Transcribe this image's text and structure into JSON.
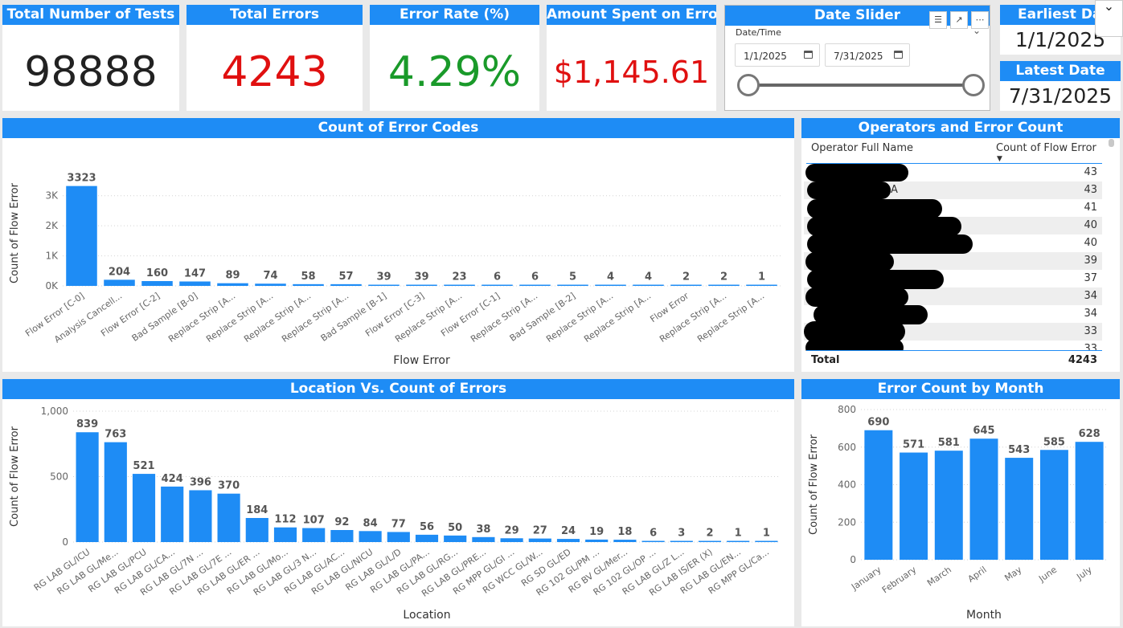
{
  "kpis": {
    "total_tests": {
      "title": "Total Number of Tests",
      "value": "98888",
      "color": "#222222"
    },
    "total_errors": {
      "title": "Total Errors",
      "value": "4243",
      "color": "#e01010"
    },
    "error_rate": {
      "title": "Error Rate (%)",
      "value": "4.29%",
      "color": "#1a9a2a"
    },
    "amount_spent": {
      "title": "Amount Spent on Errors",
      "value": "$1,145.61",
      "color": "#e01010"
    }
  },
  "date_slider": {
    "title": "Date Slider",
    "field_label": "Date/Time",
    "start": "1/1/2025",
    "end": "7/31/2025",
    "range_fraction": [
      0,
      1
    ]
  },
  "earliest_date": {
    "title": "Earliest Date",
    "value": "1/1/2025"
  },
  "latest_date": {
    "title": "Latest Date",
    "value": "7/31/2025"
  },
  "operators_table": {
    "title": "Operators and Error Count",
    "col_name": "Operator Full Name",
    "col_count": "Count of Flow Error",
    "rows": [
      "43",
      "43",
      "41",
      "40",
      "40",
      "39",
      "37",
      "34",
      "34",
      "33",
      "33"
    ],
    "partial_text": [
      "A"
    ],
    "total_label": "Total",
    "total_value": "4243"
  },
  "chart_data": [
    {
      "id": "error_codes",
      "type": "bar",
      "title": "Count of Error Codes",
      "xlabel": "Flow Error",
      "ylabel": "Count of Flow Error",
      "ylim": [
        0,
        3500
      ],
      "yticks": [
        0,
        1000,
        2000,
        3000
      ],
      "ytick_labels": [
        "0K",
        "1K",
        "2K",
        "3K"
      ],
      "categories": [
        "Flow Error [C-0]",
        "Analysis Cancell...",
        "Flow Error [C-2]",
        "Bad Sample [B-0]",
        "Replace Strip [A...",
        "Replace Strip [A...",
        "Replace Strip [A...",
        "Replace Strip [A...",
        "Bad Sample [B-1]",
        "Flow Error [C-3]",
        "Replace Strip [A...",
        "Flow Error [C-1]",
        "Replace Strip [A...",
        "Bad Sample [B-2]",
        "Replace Strip [A...",
        "Replace Strip [A...",
        "Flow Error",
        "Replace Strip [A...",
        "Replace Strip [A..."
      ],
      "values": [
        3323,
        204,
        160,
        147,
        89,
        74,
        58,
        57,
        39,
        39,
        23,
        6,
        6,
        5,
        4,
        4,
        2,
        2,
        1
      ],
      "color": "#1e8cf5"
    },
    {
      "id": "location",
      "type": "bar",
      "title": "Location Vs. Count of Errors",
      "xlabel": "Location",
      "ylabel": "Count of Flow Error",
      "ylim": [
        0,
        1000
      ],
      "yticks": [
        0,
        500,
        1000
      ],
      "ytick_labels": [
        "0",
        "500",
        "1,000"
      ],
      "categories": [
        "RG LAB GL/ICU",
        "RG LAB GL/Me...",
        "RG LAB GL/PCU",
        "RG LAB GL/CA...",
        "RG LAB GL/7N ...",
        "RG LAB GL/7E ...",
        "RG LAB GL/ER ...",
        "RG LAB GL/Mo...",
        "RG LAB GL/3 N...",
        "RG LAB GL/AC...",
        "RG LAB GL/NICU",
        "RG LAB GL/L/D",
        "RG LAB GL/PA...",
        "RG LAB GL/RG...",
        "RG LAB GL/PRE...",
        "RG MPP GL/GI ...",
        "RG WCC GL/W...",
        "RG SD GL/ED",
        "RG 102 GL/PM ...",
        "RG BV GL/Mer...",
        "RG 102 GL/OP ...",
        "RG LAB GL/Z L...",
        "RG LAB IS/ER (X)",
        "RG LAB GL/EN...",
        "RG MPP GL/Ca..."
      ],
      "values": [
        839,
        763,
        521,
        424,
        396,
        370,
        184,
        112,
        107,
        92,
        84,
        77,
        56,
        50,
        38,
        29,
        27,
        24,
        19,
        18,
        6,
        3,
        2,
        1,
        1
      ],
      "color": "#1e8cf5"
    },
    {
      "id": "month",
      "type": "bar",
      "title": "Error Count by Month",
      "xlabel": "Month",
      "ylabel": "Count of Flow Error",
      "ylim": [
        0,
        800
      ],
      "yticks": [
        0,
        200,
        400,
        600,
        800
      ],
      "ytick_labels": [
        "0",
        "200",
        "400",
        "600",
        "800"
      ],
      "categories": [
        "January",
        "February",
        "March",
        "April",
        "May",
        "June",
        "July"
      ],
      "values": [
        690,
        571,
        581,
        645,
        543,
        585,
        628
      ],
      "color": "#1e8cf5"
    }
  ]
}
